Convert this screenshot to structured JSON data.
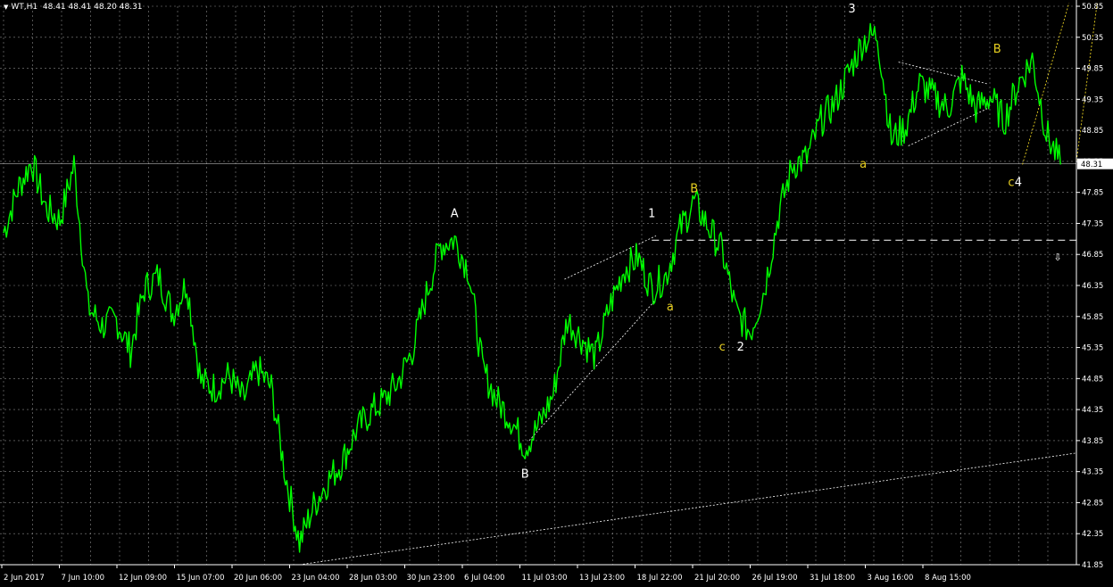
{
  "header": {
    "arrow_glyph": "▼",
    "symbol": "WT,H1",
    "ohlc": "48.41 48.41 48.20 48.31"
  },
  "colors": {
    "background": "#000000",
    "grid": "#888888",
    "price_line": "#00ff00",
    "axis_text": "#ffffff",
    "wave_primary": "#ffffff",
    "wave_secondary": "#e8d020"
  },
  "chart_data": {
    "type": "line",
    "grid": true,
    "ylim": [
      41.85,
      50.85
    ],
    "y_ticks": [
      "50.85",
      "50.35",
      "49.85",
      "49.35",
      "48.85",
      "48.35",
      "47.85",
      "47.35",
      "46.85",
      "46.35",
      "45.85",
      "45.35",
      "44.85",
      "44.35",
      "43.85",
      "43.35",
      "42.85",
      "42.35",
      "41.85"
    ],
    "x_ticks": [
      "2 Jun 2017",
      "7 Jun 10:00",
      "12 Jun 09:00",
      "15 Jun 07:00",
      "20 Jun 06:00",
      "23 Jun 04:00",
      "28 Jun 03:00",
      "30 Jun 23:00",
      "6 Jul 04:00",
      "11 Jul 03:00",
      "13 Jul 23:00",
      "18 Jul 22:00",
      "21 Jul 20:00",
      "26 Jul 19:00",
      "31 Jul 18:00",
      "3 Aug 16:00",
      "8 Aug 15:00"
    ],
    "current_price": "48.31",
    "reference_level": 47.08,
    "price_path": [
      [
        0,
        47.2
      ],
      [
        1,
        47.9
      ],
      [
        2,
        48.35
      ],
      [
        3,
        47.6
      ],
      [
        4,
        47.4
      ],
      [
        5,
        48.3
      ],
      [
        6,
        46.0
      ],
      [
        7,
        45.7
      ],
      [
        8,
        45.8
      ],
      [
        9,
        45.3
      ],
      [
        10,
        46.3
      ],
      [
        11,
        46.5
      ],
      [
        12,
        45.9
      ],
      [
        13,
        46.4
      ],
      [
        14,
        44.8
      ],
      [
        15,
        44.7
      ],
      [
        16,
        44.9
      ],
      [
        17,
        44.5
      ],
      [
        18,
        45.0
      ],
      [
        19,
        44.7
      ],
      [
        20,
        43.3
      ],
      [
        21,
        42.2
      ],
      [
        22,
        42.8
      ],
      [
        23,
        43.2
      ],
      [
        24,
        43.5
      ],
      [
        25,
        44.0
      ],
      [
        26,
        44.3
      ],
      [
        27,
        44.5
      ],
      [
        28,
        44.8
      ],
      [
        29,
        45.3
      ],
      [
        30,
        46.2
      ],
      [
        31,
        47.0
      ],
      [
        32,
        47.1
      ],
      [
        33,
        46.6
      ],
      [
        34,
        45.0
      ],
      [
        35,
        44.5
      ],
      [
        36,
        44.2
      ],
      [
        37,
        43.75
      ],
      [
        38,
        44.1
      ],
      [
        39,
        44.6
      ],
      [
        40,
        45.8
      ],
      [
        41,
        45.5
      ],
      [
        42,
        45.2
      ],
      [
        43,
        46.0
      ],
      [
        44,
        46.6
      ],
      [
        45,
        46.8
      ],
      [
        46,
        46.3
      ],
      [
        47,
        46.5
      ],
      [
        48,
        47.25
      ],
      [
        49,
        47.7
      ],
      [
        50,
        47.3
      ],
      [
        51,
        46.9
      ],
      [
        52,
        45.9
      ],
      [
        53,
        45.6
      ],
      [
        54,
        46.3
      ],
      [
        55,
        47.5
      ],
      [
        56,
        48.3
      ],
      [
        57,
        48.4
      ],
      [
        58,
        49.0
      ],
      [
        59,
        49.3
      ],
      [
        60,
        49.8
      ],
      [
        61,
        50.3
      ],
      [
        62,
        50.4
      ],
      [
        63,
        48.7
      ],
      [
        64,
        48.9
      ],
      [
        65,
        49.6
      ],
      [
        66,
        49.4
      ],
      [
        67,
        49.2
      ],
      [
        68,
        49.7
      ],
      [
        69,
        49.2
      ],
      [
        70,
        49.4
      ],
      [
        71,
        49.0
      ],
      [
        72,
        49.6
      ],
      [
        73,
        50.0
      ],
      [
        74,
        48.8
      ],
      [
        75,
        48.3
      ]
    ],
    "wave_labels": [
      {
        "text": "A",
        "color": "#ffffff",
        "at": [
          32,
          47.45
        ]
      },
      {
        "text": "B",
        "color": "#ffffff",
        "at": [
          37,
          43.25
        ]
      },
      {
        "text": "1",
        "color": "#ffffff",
        "at": [
          46,
          47.45
        ]
      },
      {
        "text": "B",
        "color": "#e8d020",
        "at": [
          49,
          47.85
        ]
      },
      {
        "text": "a",
        "color": "#e8d020",
        "at": [
          47.3,
          45.95
        ]
      },
      {
        "text": "c",
        "color": "#e8d020",
        "at": [
          51,
          45.3
        ]
      },
      {
        "text": "2",
        "color": "#ffffff",
        "at": [
          52.3,
          45.3
        ]
      },
      {
        "text": "3",
        "color": "#ffffff",
        "at": [
          60.2,
          50.75
        ]
      },
      {
        "text": "a",
        "color": "#e8d020",
        "at": [
          61,
          48.25
        ]
      },
      {
        "text": "B",
        "color": "#e8d020",
        "at": [
          70.5,
          50.1
        ]
      },
      {
        "text": "c",
        "color": "#e8d020",
        "at": [
          71.5,
          47.95
        ]
      },
      {
        "text": "4",
        "color": "#ffffff",
        "at": [
          72,
          47.95
        ]
      }
    ]
  }
}
